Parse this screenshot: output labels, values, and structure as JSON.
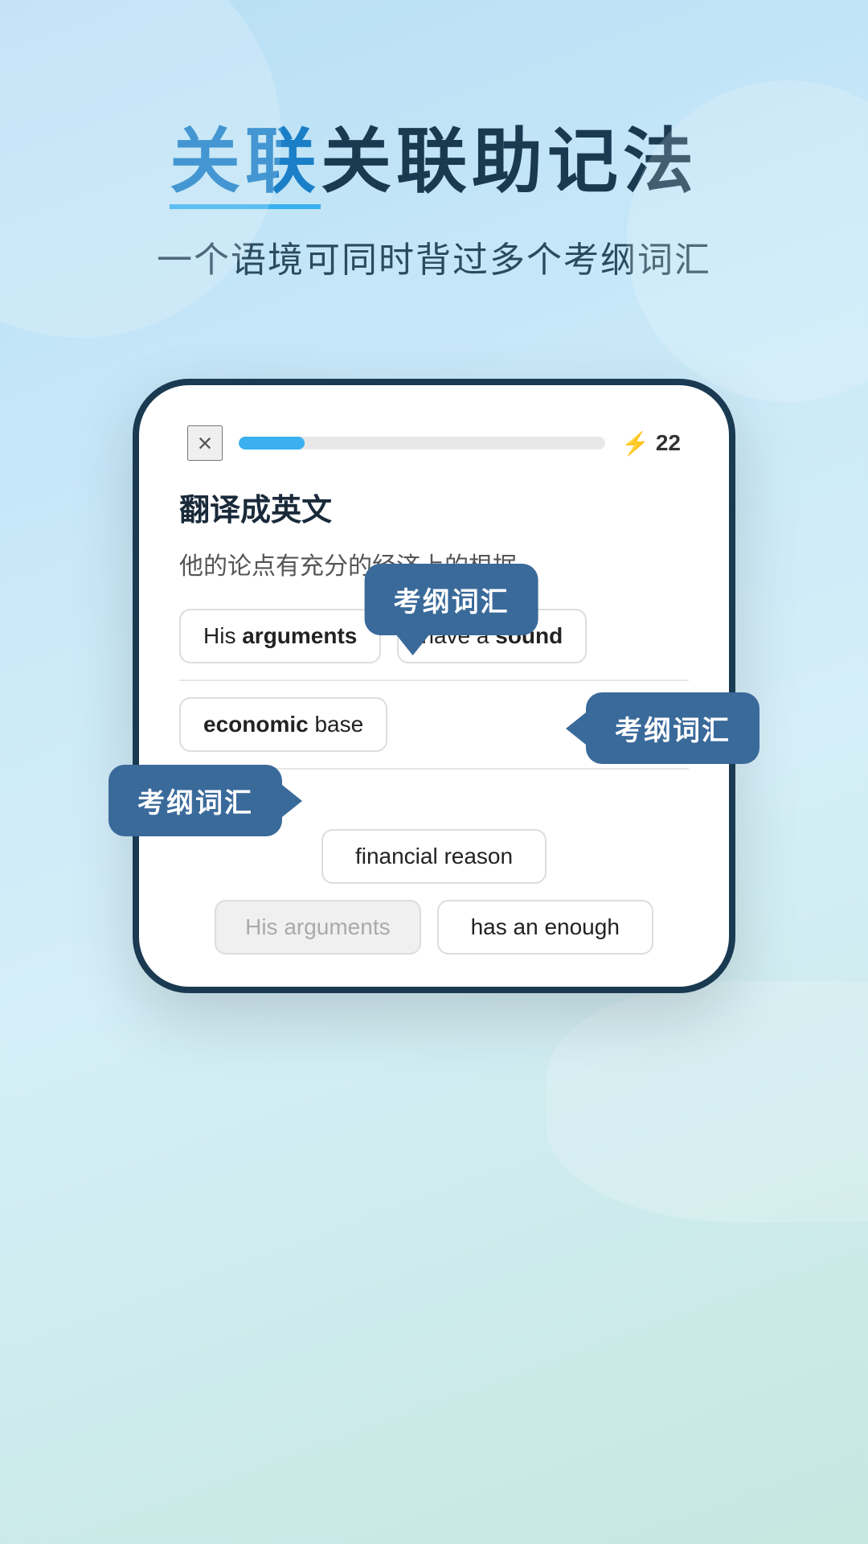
{
  "page": {
    "background": {
      "gradient_start": "#b8dff5",
      "gradient_end": "#c5e8e0"
    }
  },
  "header": {
    "title": "关联助记法",
    "title_highlight_chars": "关联",
    "subtitle": "一个语境可同时背过多个考纲词汇"
  },
  "phone": {
    "close_label": "×",
    "progress_percent": 18,
    "score": "22",
    "score_icon": "⚡",
    "card_label": "翻译成英文",
    "sentence": "他的论点有充分的经济上的根据",
    "answer_row1": [
      {
        "text": "His ",
        "bold": "arguments",
        "rest": ""
      },
      {
        "text": "have a ",
        "bold": "sound",
        "rest": ""
      }
    ],
    "answer_row2": [
      {
        "text": "",
        "bold": "economic",
        "rest": " base"
      }
    ],
    "bottom_options": [
      {
        "text": "financial reason",
        "dimmed": false
      },
      {
        "text": "has an enough",
        "dimmed": false
      },
      {
        "text": "His arguments",
        "dimmed": true
      }
    ]
  },
  "tooltips": [
    {
      "id": "tooltip-1",
      "text": "考纲词汇"
    },
    {
      "id": "tooltip-2",
      "text": "考纲词汇"
    },
    {
      "id": "tooltip-3",
      "text": "考纲词汇"
    }
  ]
}
